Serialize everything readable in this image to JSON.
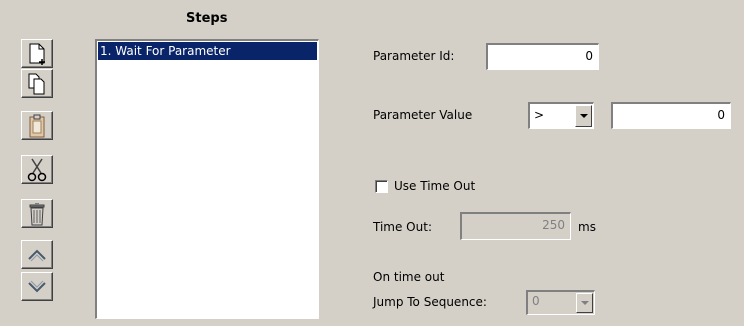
{
  "steps": {
    "title": "Steps",
    "items": [
      "1. Wait For Parameter"
    ]
  },
  "toolbar": {
    "icons": [
      "new-icon",
      "copy-icon",
      "paste-icon",
      "cut-icon",
      "delete-icon",
      "move-up-icon",
      "move-down-icon"
    ]
  },
  "form": {
    "parameter_id_label": "Parameter Id:",
    "parameter_id_value": "0",
    "parameter_value_label": "Parameter Value",
    "operator_value": ">",
    "parameter_value_value": "0",
    "use_timeout_label": "Use Time Out",
    "use_timeout_checked": false,
    "timeout_label": "Time Out:",
    "timeout_value": "250",
    "timeout_unit": "ms",
    "on_timeout_label": "On time out",
    "jump_label": "Jump To Sequence:",
    "jump_value": "0"
  }
}
